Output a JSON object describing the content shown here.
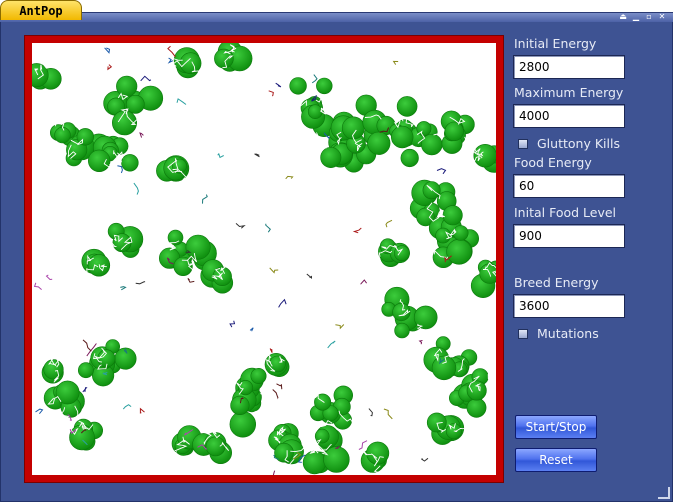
{
  "window": {
    "title": "AntPop",
    "controls": [
      "restore-icon",
      "minimize-icon",
      "maximize-icon",
      "close-icon"
    ]
  },
  "controls": {
    "initial_energy_label": "Initial Energy",
    "initial_energy_value": "2800",
    "maximum_energy_label": "Maximum Energy",
    "maximum_energy_value": "4000",
    "gluttony_kills_label": "Gluttony Kills",
    "food_energy_label": "Food Energy",
    "food_energy_value": "60",
    "initial_food_label": "Inital Food Level",
    "initial_food_value": "900",
    "breed_energy_label": "Breed Energy",
    "breed_energy_value": "3600",
    "mutations_label": "Mutations",
    "start_stop_label": "Start/Stop",
    "reset_label": "Reset"
  },
  "colors": {
    "frame": "#3e5393",
    "border": "#c40000",
    "food": "#1aa51a",
    "tab": "#f1b800"
  }
}
